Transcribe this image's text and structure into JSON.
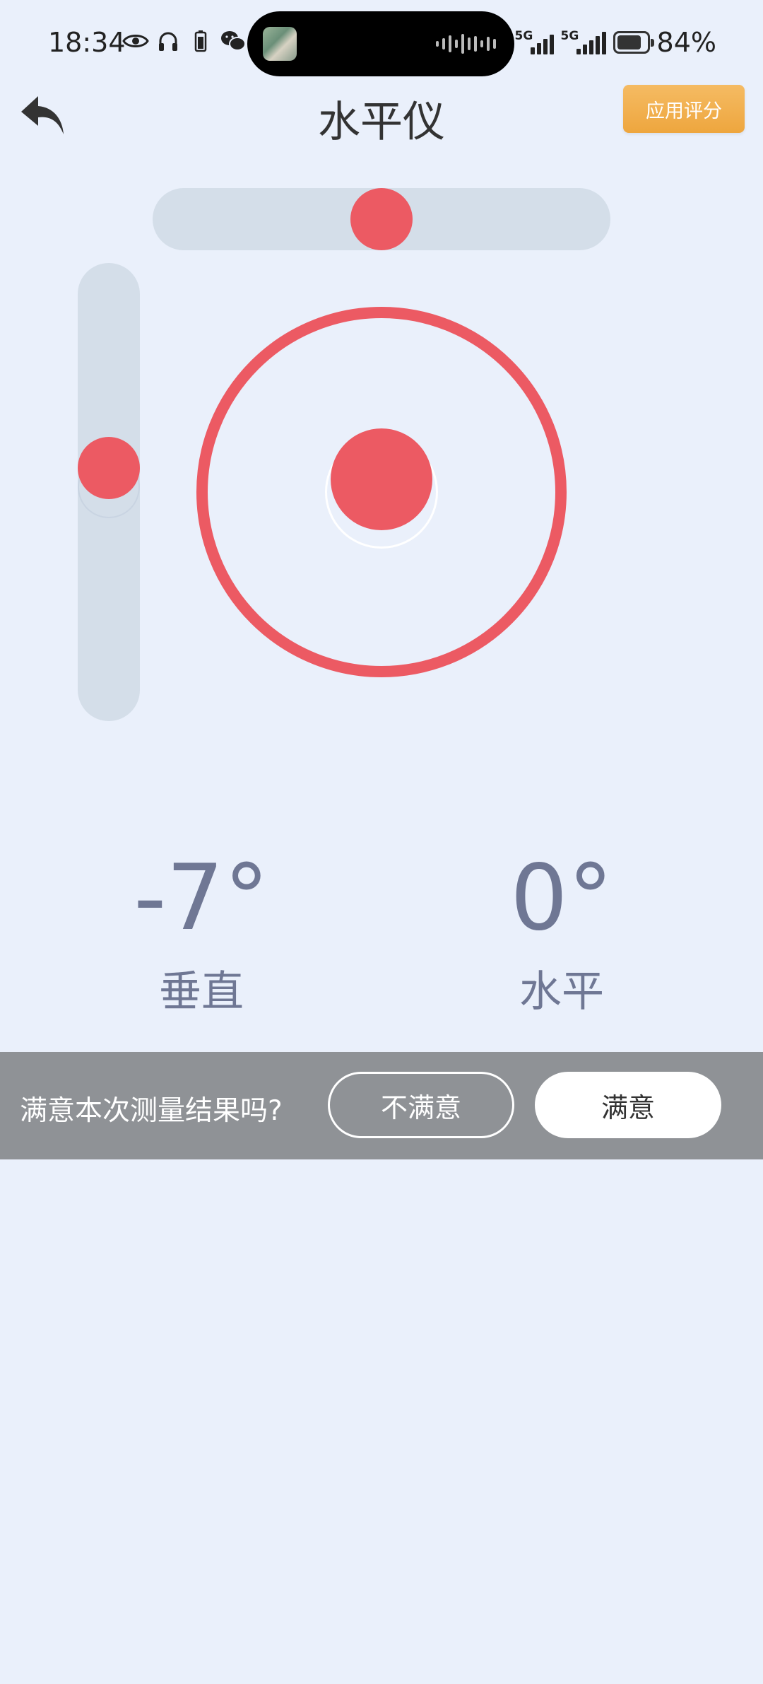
{
  "status_bar": {
    "time": "18:34",
    "signal1_tag": "5G",
    "signal2_tag": "5G",
    "battery_percent_text": "84%",
    "battery_level": 0.84,
    "left_icons": [
      "eye-icon",
      "headphones-icon",
      "battery-small-icon",
      "wechat-icon"
    ]
  },
  "header": {
    "title": "水平仪",
    "rate_button": "应用评分"
  },
  "level": {
    "horizontal_bubble_position": 0.5,
    "vertical_bubble_position": 0.44,
    "circle_bubble_offset_y": -0.07,
    "accent_color": "#ec5a63",
    "track_color": "#d4dee9"
  },
  "readings": {
    "vertical": {
      "value": "-7°",
      "label": "垂直"
    },
    "horizontal": {
      "value": "0°",
      "label": "水平"
    }
  },
  "feedback": {
    "question": "满意本次测量结果吗?",
    "no_label": "不满意",
    "yes_label": "满意"
  }
}
